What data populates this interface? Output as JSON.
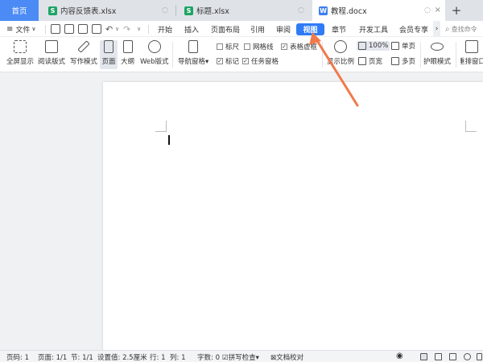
{
  "tabs": {
    "home": "首页",
    "docs": [
      {
        "icon": "S",
        "title": "内容反馈表.xlsx",
        "kind": "xls"
      },
      {
        "icon": "S",
        "title": "标题.xlsx",
        "kind": "xls"
      },
      {
        "icon": "W",
        "title": "教程.docx",
        "kind": "doc"
      }
    ],
    "add": "+"
  },
  "menu": {
    "file": "文件",
    "items": [
      "开始",
      "插入",
      "页面布局",
      "引用",
      "审阅",
      "视图",
      "章节",
      "开发工具",
      "会员专享"
    ],
    "active": "视图",
    "more": "›",
    "search_placeholder": "查找命令"
  },
  "ribbon": {
    "views": [
      "全屏显示",
      "阅读版式",
      "写作模式",
      "页面",
      "大纲",
      "Web版式"
    ],
    "selected_view": "页面",
    "nav_pane": "导航窗格",
    "checkboxes": [
      {
        "label": "标尺",
        "checked": false
      },
      {
        "label": "网格线",
        "checked": false
      },
      {
        "label": "表格虚框",
        "checked": true
      },
      {
        "label": "标记",
        "checked": true
      },
      {
        "label": "任务窗格",
        "checked": true
      }
    ],
    "zoom_label": "显示比例",
    "zoom_value": "100%",
    "page_width": "页宽",
    "single_page": "单页",
    "multi_page": "多页",
    "eye_mode": "护眼模式",
    "rearrange": "重排窗口"
  },
  "status": {
    "page": "页码: 1",
    "pages": "页面: 1/1",
    "section": "节: 1/1",
    "setting": "设置值: 2.5厘米",
    "row": "行: 1",
    "col": "列: 1",
    "words": "字数: 0",
    "spell": "拼写检查",
    "proof": "文档校对"
  },
  "colors": {
    "accent": "#2f7cf6",
    "arrow": "#f07a4a",
    "xls": "#1fa464",
    "doc": "#3d7ef0"
  }
}
